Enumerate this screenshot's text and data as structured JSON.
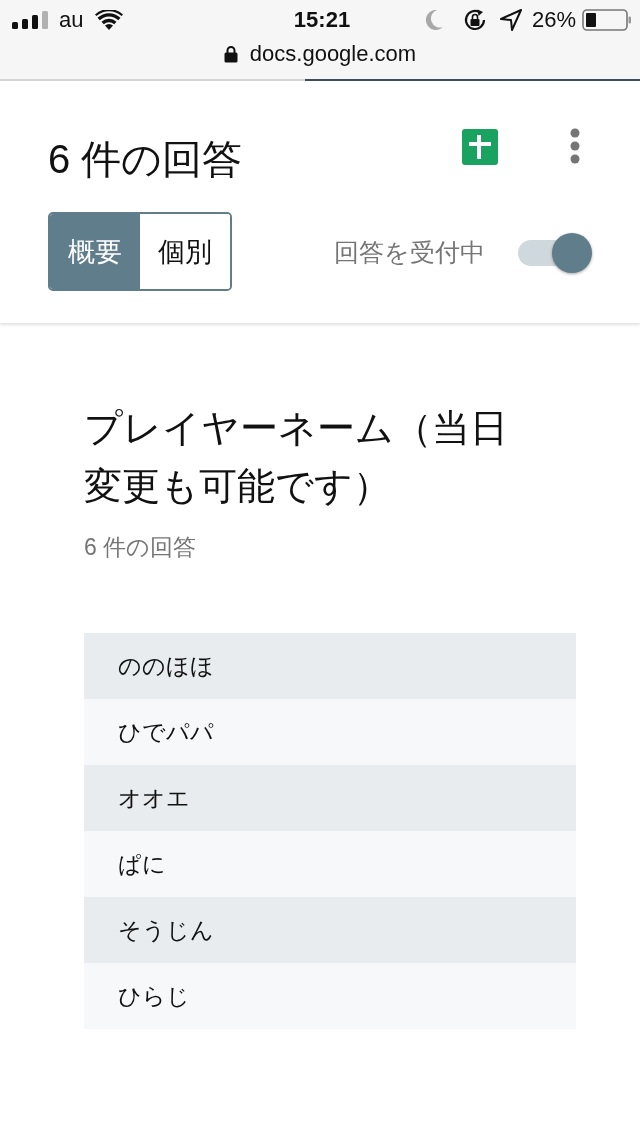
{
  "status_bar": {
    "carrier": "au",
    "time": "15:21",
    "battery": "26%"
  },
  "address_bar": {
    "url": "docs.google.com"
  },
  "header": {
    "title": "6 件の回答",
    "tabs": [
      {
        "label": "概要",
        "selected": true
      },
      {
        "label": "個別",
        "selected": false
      }
    ],
    "accepting": {
      "label": "回答を受付中",
      "on": true
    }
  },
  "question": {
    "title": "プレイヤーネーム（当日変更も可能です）",
    "count": "6 件の回答",
    "answers": [
      "ののほほ",
      "ひでパパ",
      "オオエ",
      "ぱに",
      "そうじん",
      "ひらじ"
    ]
  }
}
